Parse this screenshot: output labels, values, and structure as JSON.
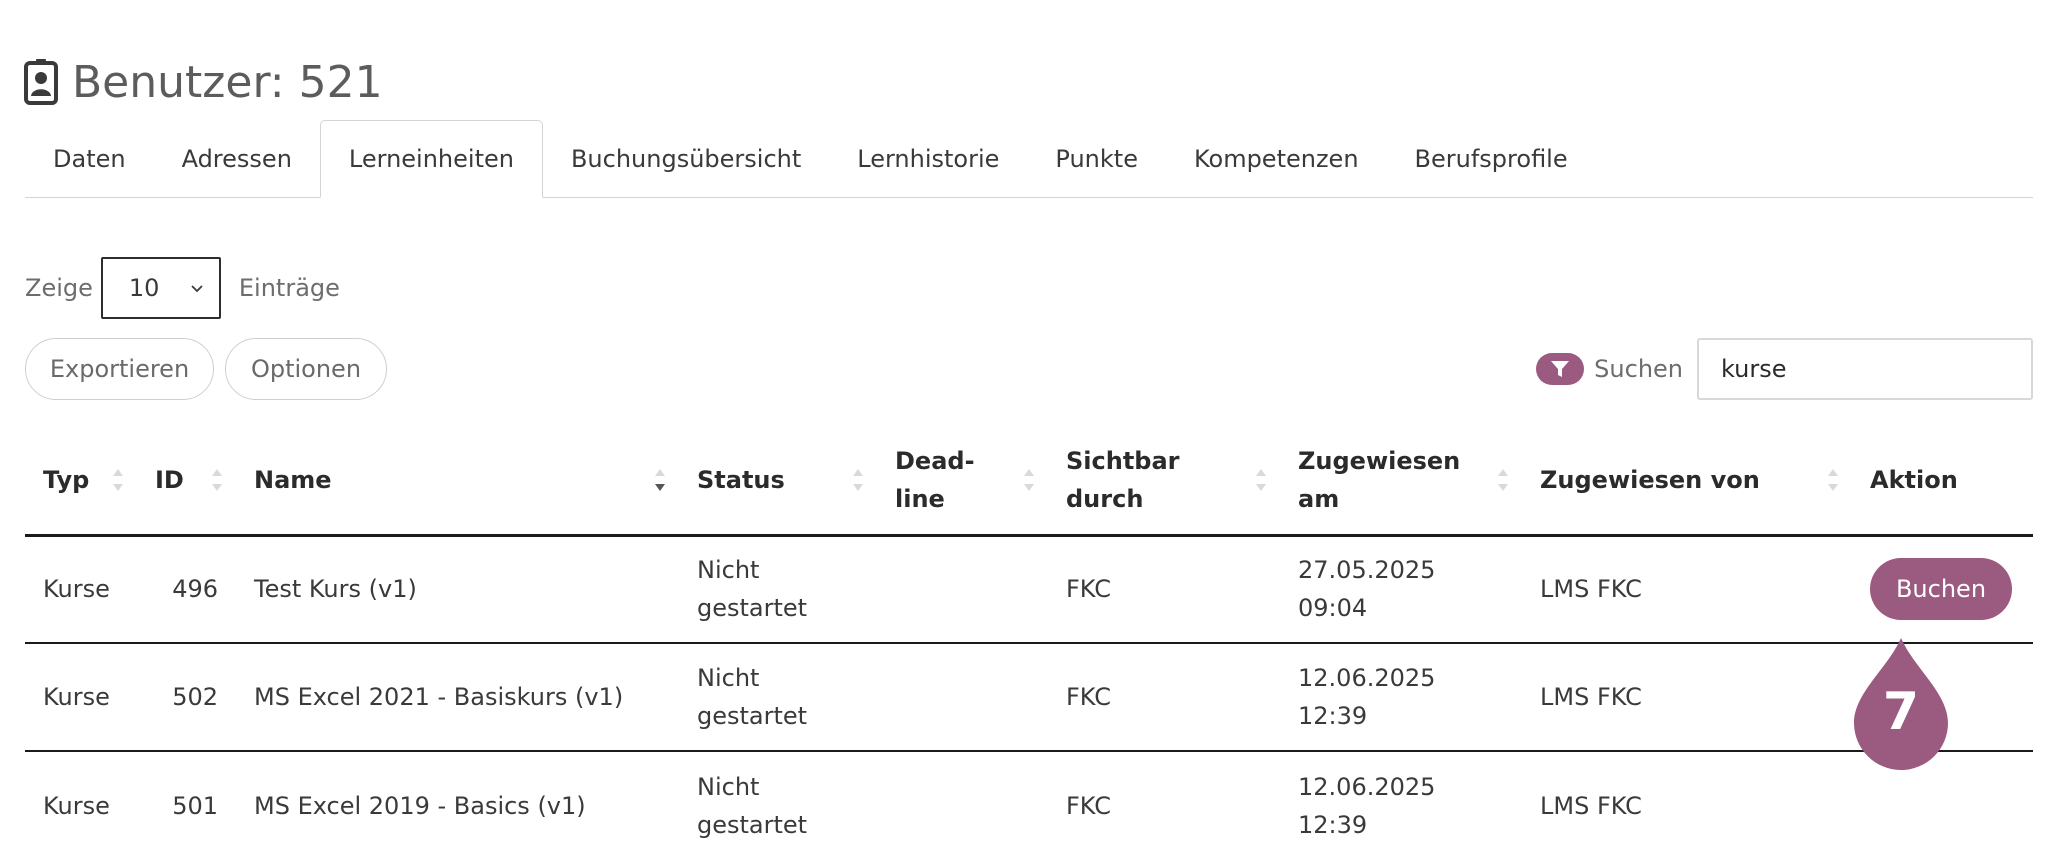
{
  "header": {
    "title": "Benutzer: 521",
    "icon": "contact-card-icon"
  },
  "tabs": [
    {
      "label": "Daten",
      "active": false
    },
    {
      "label": "Adressen",
      "active": false
    },
    {
      "label": "Lerneinheiten",
      "active": true
    },
    {
      "label": "Buchungsübersicht",
      "active": false
    },
    {
      "label": "Lernhistorie",
      "active": false
    },
    {
      "label": "Punkte",
      "active": false
    },
    {
      "label": "Kompetenzen",
      "active": false
    },
    {
      "label": "Berufsprofile",
      "active": false
    }
  ],
  "length": {
    "prefix": "Zeige",
    "value": "10",
    "suffix": "Einträge"
  },
  "toolbar": {
    "export_label": "Exportieren",
    "options_label": "Optionen"
  },
  "search": {
    "label": "Suchen",
    "value": "kurse",
    "icon": "filter-icon"
  },
  "table": {
    "columns": [
      "Typ",
      "ID",
      "Name",
      "Status",
      "Dead-\nline",
      "Sichtbar\ndurch",
      "Zugewiesen\nam",
      "Zugewiesen von",
      "Aktion"
    ],
    "rows": [
      {
        "typ": "Kurse",
        "id": "496",
        "name": "Test Kurs (v1)",
        "status": "Nicht\ngestartet",
        "deadline": "",
        "sichtbar": "FKC",
        "zugewiesen_am": "27.05.2025 09:04",
        "zugewiesen_von": "LMS FKC",
        "aktion": "Buchen"
      },
      {
        "typ": "Kurse",
        "id": "502",
        "name": "MS Excel 2021 - Basiskurs (v1)",
        "status": "Nicht\ngestartet",
        "deadline": "",
        "sichtbar": "FKC",
        "zugewiesen_am": "12.06.2025 12:39",
        "zugewiesen_von": "LMS FKC",
        "aktion": ""
      },
      {
        "typ": "Kurse",
        "id": "501",
        "name": "MS Excel 2019 - Basics (v1)",
        "status": "Nicht\ngestartet",
        "deadline": "",
        "sichtbar": "FKC",
        "zugewiesen_am": "12.06.2025 12:39",
        "zugewiesen_von": "LMS FKC",
        "aktion": ""
      }
    ]
  },
  "step_marker": {
    "number": "7"
  },
  "colors": {
    "accent": "#9b5a80",
    "text": "#2b2b2b",
    "muted": "#6d6d6d",
    "border": "#d4d4d4"
  }
}
